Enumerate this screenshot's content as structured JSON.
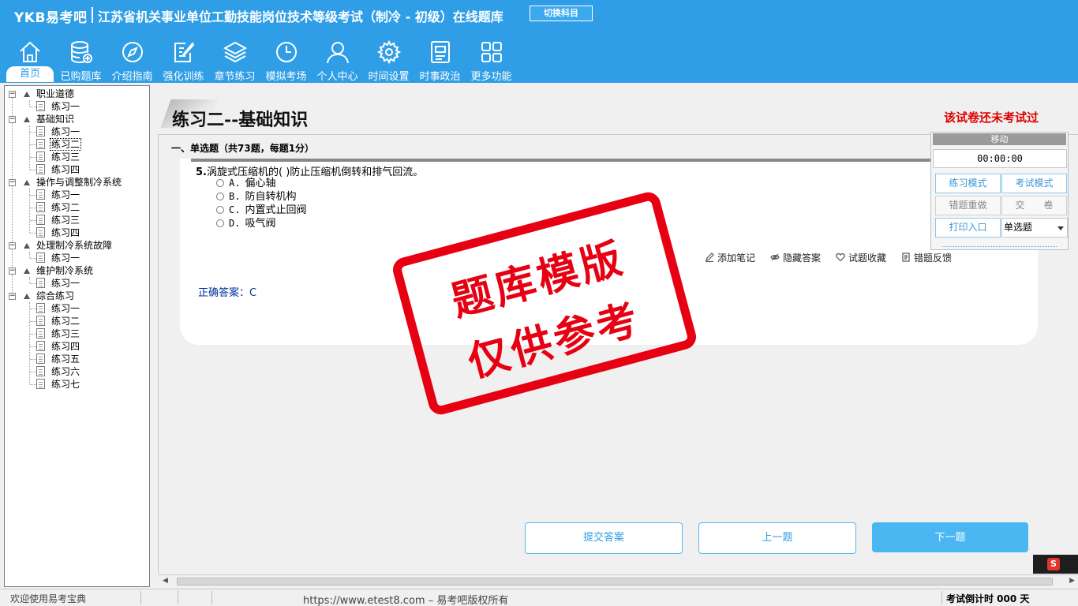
{
  "header": {
    "brand": "YKB易考吧",
    "exam_title": "江苏省机关事业单位工勤技能岗位技术等级考试（制冷 - 初级）在线题库",
    "switch_subject": "切换科目"
  },
  "nav": [
    {
      "label": "首页",
      "icon": "home-icon",
      "active": true
    },
    {
      "label": "已购题库",
      "icon": "database-icon"
    },
    {
      "label": "介绍指南",
      "icon": "compass-icon"
    },
    {
      "label": "强化训练",
      "icon": "edit-icon"
    },
    {
      "label": "章节练习",
      "icon": "layers-icon"
    },
    {
      "label": "模拟考场",
      "icon": "clock-icon"
    },
    {
      "label": "个人中心",
      "icon": "user-icon"
    },
    {
      "label": "时间设置",
      "icon": "gear-icon"
    },
    {
      "label": "时事政治",
      "icon": "news-icon"
    },
    {
      "label": "更多功能",
      "icon": "grid-icon"
    }
  ],
  "tree": [
    {
      "label": "职业道德",
      "children": [
        "练习一"
      ]
    },
    {
      "label": "基础知识",
      "children": [
        "练习一",
        "练习二",
        "练习三",
        "练习四"
      ]
    },
    {
      "label": "操作与调整制冷系统",
      "children": [
        "练习一",
        "练习二",
        "练习三",
        "练习四"
      ]
    },
    {
      "label": "处理制冷系统故障",
      "children": [
        "练习一"
      ]
    },
    {
      "label": "维护制冷系统",
      "children": [
        "练习一"
      ]
    },
    {
      "label": "综合练习",
      "children": [
        "练习一",
        "练习二",
        "练习三",
        "练习四",
        "练习五",
        "练习六",
        "练习七"
      ]
    }
  ],
  "paper": {
    "title": "练习二--基础知识",
    "status": "该试卷还未考试过",
    "section_header": "一、单选题（共73题，每题1分）"
  },
  "question": {
    "number": "5.",
    "text": "涡旋式压缩机的( )防止压缩机倒转和排气回流。",
    "options": [
      {
        "key": "A.",
        "text": "偏心轴"
      },
      {
        "key": "B.",
        "text": "防自转机构"
      },
      {
        "key": "C.",
        "text": "内置式止回阀"
      },
      {
        "key": "D.",
        "text": "吸气阀"
      }
    ],
    "answer_label": "正确答案：",
    "answer": "C"
  },
  "actions": {
    "add_note": "添加笔记",
    "hide_answer": "隐藏答案",
    "favorite": "试题收藏",
    "feedback": "错题反馈"
  },
  "buttons": {
    "submit": "提交答案",
    "prev": "上一题",
    "next": "下一题"
  },
  "stamp": {
    "line1": "题库模版",
    "line2": "仅供参考"
  },
  "timer_panel": {
    "move": "移动",
    "time": "00:00:00",
    "practice_mode": "练习模式",
    "exam_mode": "考试模式",
    "redo_wrong": "错题重做",
    "submit_paper": "交　　卷",
    "print": "打印入口",
    "type_select": "单选题"
  },
  "statusbar": {
    "welcome": "欢迎使用易考宝典",
    "copyright": "https://www.etest8.com – 易考吧版权所有",
    "countdown": "考试倒计时 000 天"
  },
  "colors": {
    "header_bg": "#2f9ee6",
    "accent": "#4ab6f2",
    "status_red": "#d00000",
    "stamp_red": "#e60012"
  }
}
